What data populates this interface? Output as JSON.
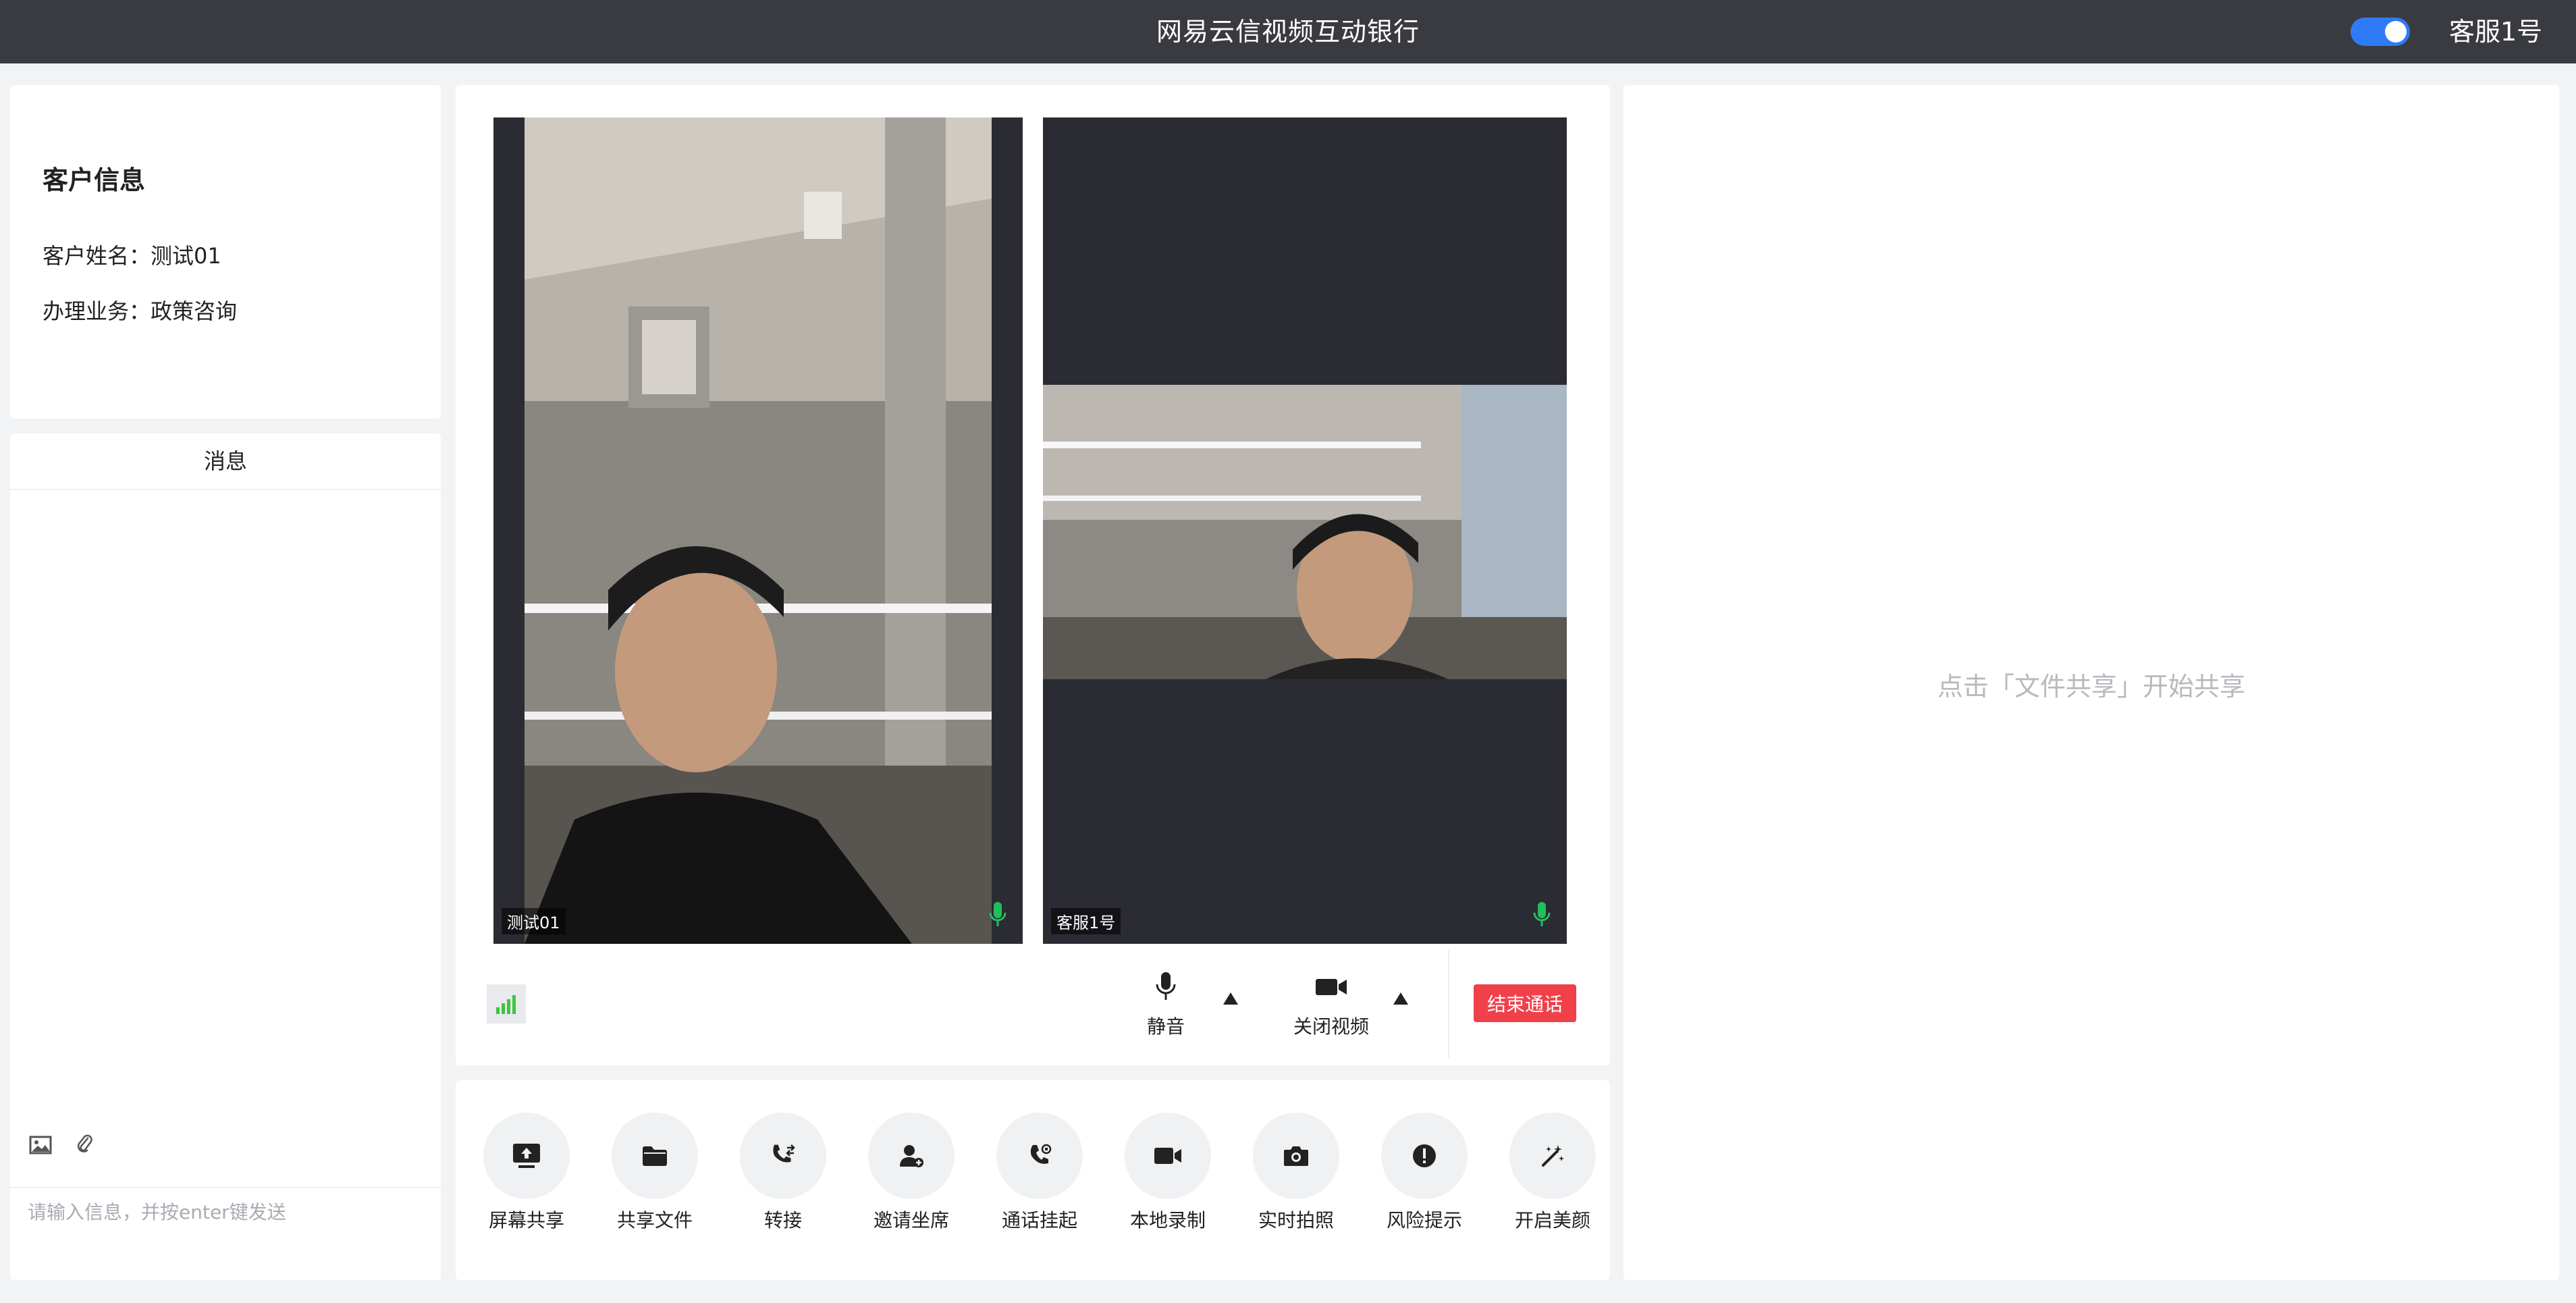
{
  "header": {
    "title": "网易云信视频互动银行",
    "agent_name": "客服1号",
    "toggle_on": true
  },
  "customer": {
    "heading": "客户信息",
    "name_label": "客户姓名：",
    "name_value": "测试01",
    "business_label": "办理业务：",
    "business_value": "政策咨询"
  },
  "messages": {
    "heading": "消息",
    "input_placeholder": "请输入信息，并按enter键发送",
    "tools": [
      "image-icon",
      "paperclip-icon"
    ]
  },
  "video": {
    "left_label": "测试01",
    "right_label": "客服1号",
    "mic_color": "#1fbf5c"
  },
  "controls": {
    "mute_label": "静音",
    "video_off_label": "关闭视频",
    "end_call_label": "结束通话",
    "end_call_color": "#f0414b",
    "signal_color": "#3ec53e"
  },
  "actions": [
    {
      "label": "屏幕共享",
      "icon": "screen-share-icon"
    },
    {
      "label": "共享文件",
      "icon": "folder-icon"
    },
    {
      "label": "转接",
      "icon": "transfer-call-icon"
    },
    {
      "label": "邀请坐席",
      "icon": "invite-agent-icon"
    },
    {
      "label": "通话挂起",
      "icon": "hold-call-icon"
    },
    {
      "label": "本地录制",
      "icon": "video-camera-icon"
    },
    {
      "label": "实时拍照",
      "icon": "camera-icon"
    },
    {
      "label": "风险提示",
      "icon": "alert-icon"
    },
    {
      "label": "开启美颜",
      "icon": "magic-wand-icon"
    }
  ],
  "share": {
    "hint": "点击「文件共享」开始共享"
  }
}
